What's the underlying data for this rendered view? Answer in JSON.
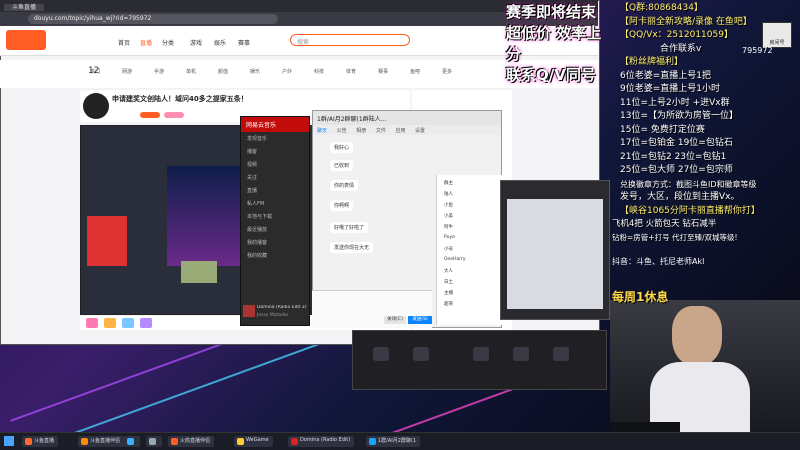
{
  "browser": {
    "tab_title": "斗鱼直播",
    "url": "douyu.com/topic/yihua_wj?rid=795972",
    "nav_items": [
      "首页",
      "直播",
      "分类",
      "游戏",
      "娱乐",
      "赛事"
    ],
    "active_nav": 1,
    "search_placeholder": "搜索",
    "categories": [
      "热门",
      "网游",
      "手游",
      "单机",
      "颜值",
      "娱乐",
      "户外",
      "科技",
      "体育",
      "赛事",
      "鱼吧",
      "更多"
    ]
  },
  "stream": {
    "title": "申请建奖文创陆人！域问40多之提家五条！",
    "viewer_count": "12"
  },
  "music_app": {
    "title": "网易云音乐",
    "items": [
      "发现音乐",
      "播客",
      "视频",
      "关注",
      "直播",
      "私人FM",
      "本地与下载",
      "最近播放",
      "我的播客",
      "我的收藏"
    ],
    "now_playing": "Domina (Radio Edit 2)",
    "artist": "Jessy Matador"
  },
  "qq_chat": {
    "title": "1群/AI月2群聊(1群陆人...",
    "tabs": [
      "聊天",
      "公告",
      "相册",
      "文件",
      "应用",
      "设置"
    ],
    "messages": [
      "我好心",
      "已收到",
      "你的表情",
      "你啊啊",
      "好哦了好啦了",
      "发送你现在大无"
    ],
    "members": [
      "群主",
      "陆人",
      "小鱼",
      "小美",
      "阿牛",
      "Puyo",
      "小号",
      "OneHarry",
      "大人",
      "日土",
      "主播",
      "超哥"
    ],
    "send_button": "发送(S)",
    "close_button": "关闭(C)"
  },
  "overlay": {
    "promo_lines": [
      "赛季即将结束",
      "超低价 效率上分",
      "联系Q/V同号"
    ],
    "info_lines": [
      "【Q群:80868434】",
      "【阿卡丽全新攻略/录像 在鱼吧】",
      "【QQ/Vx：2512011059】",
      "合作联系v",
      "【粉丝牌福利】",
      "6位老婆=直播上号1把",
      "9位老婆=直播上号1小时",
      "11位=上号2小时 +进Vx群",
      "13位=【为所欲为房管一位】",
      "15位= 免费打定位赛",
      "17位=包铂金  19位=包钻石",
      "21位=包钻2   23位=包钻1",
      "25位=包大师  27位=包宗师",
      "兑换徽章方式：截图斗鱼ID和徽章等级",
      "发号，大区，段位到主播Vx。",
      "【峡谷1065分阿卡丽直播帮你打】"
    ],
    "lower_lines": [
      "飞机4把  火箭包天  钻石减半",
      "钻粉=房管+打号  代打至臻/双城等级!"
    ],
    "streamer_tag": "抖音：斗鱼、托尼老师Akl",
    "weekly_rest": "每周1休息",
    "room_badge": "房间号",
    "room_number": "795972"
  },
  "taskbar": {
    "items": [
      "斗鱼直播",
      "斗鱼直播伴侣",
      "",
      "",
      "火箭直播伴侣",
      "WeGame",
      "Domina (Radio Edit)",
      "1群/AI月2群聊(1"
    ],
    "icon_colors": [
      "#ff6a2b",
      "#ff8a00",
      "#3ab0ff",
      "#9aa",
      "#ff5d23",
      "#ffcc33",
      "#e02020",
      "#19a6ff"
    ]
  },
  "colors": {
    "douyu_orange": "#ff5d23",
    "overlay_yellow": "#ffef6a"
  }
}
